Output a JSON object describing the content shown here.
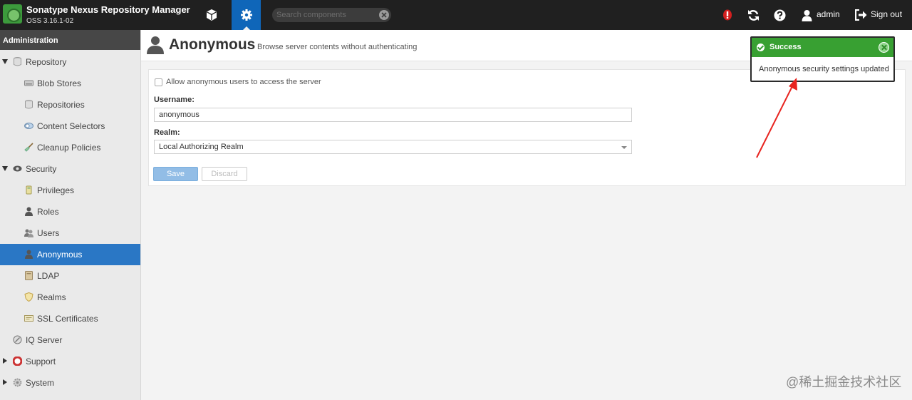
{
  "header": {
    "app_title": "Sonatype Nexus Repository Manager",
    "version": "OSS 3.16.1-02",
    "search_placeholder": "Search components",
    "user": "admin",
    "sign_out": "Sign out"
  },
  "sidebar": {
    "heading": "Administration",
    "items": [
      {
        "label": "Repository"
      },
      {
        "label": "Blob Stores"
      },
      {
        "label": "Repositories"
      },
      {
        "label": "Content Selectors"
      },
      {
        "label": "Cleanup Policies"
      },
      {
        "label": "Security"
      },
      {
        "label": "Privileges"
      },
      {
        "label": "Roles"
      },
      {
        "label": "Users"
      },
      {
        "label": "Anonymous"
      },
      {
        "label": "LDAP"
      },
      {
        "label": "Realms"
      },
      {
        "label": "SSL Certificates"
      },
      {
        "label": "IQ Server"
      },
      {
        "label": "Support"
      },
      {
        "label": "System"
      }
    ]
  },
  "page": {
    "title": "Anonymous",
    "subtitle": "Browse server contents without authenticating"
  },
  "form": {
    "allow_label": "Allow anonymous users to access the server",
    "username_label": "Username:",
    "username_value": "anonymous",
    "realm_label": "Realm:",
    "realm_value": "Local Authorizing Realm",
    "save": "Save",
    "discard": "Discard"
  },
  "toast": {
    "title": "Success",
    "message": "Anonymous security settings updated"
  },
  "watermark": "@稀土掘金技术社区",
  "colors": {
    "header_bg": "#202020",
    "active_blue": "#0f66b9",
    "selected_nav": "#2a77c5",
    "success_green": "#38a032",
    "annotation_red": "#e8231e"
  }
}
